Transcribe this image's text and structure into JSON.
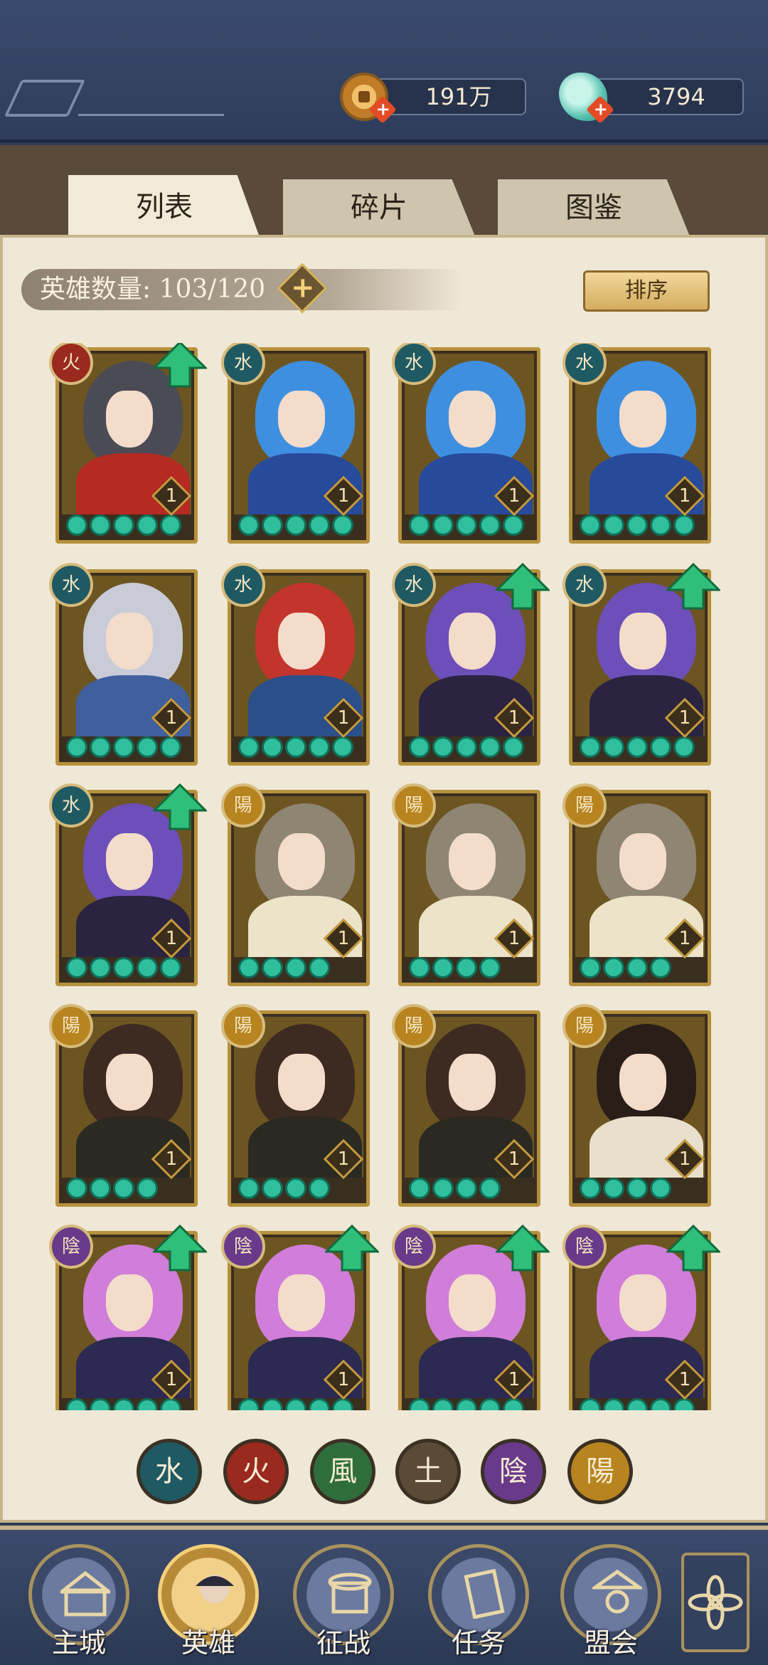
{
  "currency": {
    "coins": {
      "icon": "copper-coin-icon",
      "value": "191万"
    },
    "gems": {
      "icon": "jade-pearl-icon",
      "value": "3794"
    }
  },
  "tabs": [
    {
      "label": "列表",
      "active": true
    },
    {
      "label": "碎片",
      "active": false
    },
    {
      "label": "图鉴",
      "active": false
    }
  ],
  "hero_count": {
    "label": "英雄数量: 103/120"
  },
  "sort_button": {
    "label": "排序"
  },
  "heroes": [
    {
      "element": "火",
      "level": "1",
      "stars": 5,
      "upgrade": true,
      "hair": "#4b4b55",
      "body": "#b52a22"
    },
    {
      "element": "水",
      "level": "1",
      "stars": 5,
      "upgrade": false,
      "hair": "#3f8fe0",
      "body": "#284a9a"
    },
    {
      "element": "水",
      "level": "1",
      "stars": 5,
      "upgrade": false,
      "hair": "#3f8fe0",
      "body": "#284a9a"
    },
    {
      "element": "水",
      "level": "1",
      "stars": 5,
      "upgrade": false,
      "hair": "#3f8fe0",
      "body": "#284a9a"
    },
    {
      "element": "水",
      "level": "1",
      "stars": 5,
      "upgrade": false,
      "hair": "#c9ccd6",
      "body": "#3f5f9f"
    },
    {
      "element": "水",
      "level": "1",
      "stars": 5,
      "upgrade": false,
      "hair": "#c2352c",
      "body": "#2a4f8a"
    },
    {
      "element": "水",
      "level": "1",
      "stars": 5,
      "upgrade": true,
      "hair": "#6c4fb8",
      "body": "#2a2440"
    },
    {
      "element": "水",
      "level": "1",
      "stars": 5,
      "upgrade": true,
      "hair": "#6c4fb8",
      "body": "#2a2440"
    },
    {
      "element": "水",
      "level": "1",
      "stars": 5,
      "upgrade": true,
      "hair": "#6c4fb8",
      "body": "#2a2440"
    },
    {
      "element": "陽",
      "level": "1",
      "stars": 4,
      "upgrade": false,
      "hair": "#8f8573",
      "body": "#ece3c9"
    },
    {
      "element": "陽",
      "level": "1",
      "stars": 4,
      "upgrade": false,
      "hair": "#8f8573",
      "body": "#ece3c9"
    },
    {
      "element": "陽",
      "level": "1",
      "stars": 4,
      "upgrade": false,
      "hair": "#8f8573",
      "body": "#ece3c9"
    },
    {
      "element": "陽",
      "level": "1",
      "stars": 4,
      "upgrade": false,
      "hair": "#3d2b22",
      "body": "#2a2a22"
    },
    {
      "element": "陽",
      "level": "1",
      "stars": 4,
      "upgrade": false,
      "hair": "#3d2b22",
      "body": "#2a2a22"
    },
    {
      "element": "陽",
      "level": "1",
      "stars": 4,
      "upgrade": false,
      "hair": "#3d2b22",
      "body": "#2a2a22"
    },
    {
      "element": "陽",
      "level": "1",
      "stars": 4,
      "upgrade": false,
      "hair": "#2a1e18",
      "body": "#e8e0cc"
    },
    {
      "element": "陰",
      "level": "1",
      "stars": 5,
      "upgrade": true,
      "hair": "#d07ed9",
      "body": "#2c2a52"
    },
    {
      "element": "陰",
      "level": "1",
      "stars": 5,
      "upgrade": true,
      "hair": "#d07ed9",
      "body": "#2c2a52"
    },
    {
      "element": "陰",
      "level": "1",
      "stars": 5,
      "upgrade": true,
      "hair": "#d07ed9",
      "body": "#2c2a52"
    },
    {
      "element": "陰",
      "level": "1",
      "stars": 5,
      "upgrade": true,
      "hair": "#d07ed9",
      "body": "#2c2a52"
    }
  ],
  "element_colors": {
    "火": "#9a2a1e",
    "水": "#1f5a63",
    "陽": "#b8841f",
    "陰": "#6a3a8a"
  },
  "element_filters": [
    {
      "glyph": "水",
      "name": "water-filter-button",
      "color": "#1f5a63"
    },
    {
      "glyph": "火",
      "name": "fire-filter-button",
      "color": "#9a2a1e"
    },
    {
      "glyph": "風",
      "name": "wind-filter-button",
      "color": "#2f6e3c"
    },
    {
      "glyph": "土",
      "name": "earth-filter-button",
      "color": "#5a4a36"
    },
    {
      "glyph": "陰",
      "name": "yin-filter-button",
      "color": "#6a3a8a"
    },
    {
      "glyph": "陽",
      "name": "yang-filter-button",
      "color": "#b8841f"
    }
  ],
  "bottom_nav": [
    {
      "label": "主城",
      "icon": "palace-icon",
      "active": false
    },
    {
      "label": "英雄",
      "icon": "hero-portrait-icon",
      "active": true
    },
    {
      "label": "征战",
      "icon": "battle-drum-icon",
      "active": false
    },
    {
      "label": "任务",
      "icon": "scroll-icon",
      "active": false
    },
    {
      "label": "盟会",
      "icon": "pavilion-icon",
      "active": false
    }
  ],
  "extra_button": {
    "icon": "flower-menu-icon"
  }
}
